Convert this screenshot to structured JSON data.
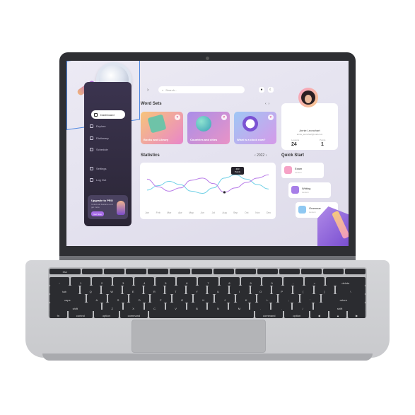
{
  "sidebar": {
    "items": [
      {
        "label": "Dashboard",
        "icon": "home-icon"
      },
      {
        "label": "Explore",
        "icon": "compass-icon"
      },
      {
        "label": "Dictionary",
        "icon": "book-icon"
      },
      {
        "label": "Schedule",
        "icon": "calendar-icon"
      },
      {
        "label": "Settings",
        "icon": "gear-icon"
      },
      {
        "label": "Log Out",
        "icon": "logout-icon"
      }
    ],
    "promo": {
      "title": "Upgrade to PRO",
      "subtitle": "Unlock all features and get more",
      "button": "Get Now"
    }
  },
  "search": {
    "placeholder": "Search..."
  },
  "word_sets": {
    "title": "Word Sets",
    "cards": [
      {
        "label": "Books and Library",
        "colors": [
          "#f7c47a",
          "#e986c9"
        ]
      },
      {
        "label": "Countries and cities",
        "colors": [
          "#a98ee9",
          "#e993c6"
        ]
      },
      {
        "label": "What is a clock now?",
        "colors": [
          "#9ec7f5",
          "#d59ae9"
        ]
      }
    ]
  },
  "profile": {
    "name": "Annie Leonchart",
    "email": "annie_leonchart@mail.com",
    "stats": [
      {
        "label": "Lessons",
        "value": "24"
      },
      {
        "label": "Points",
        "value": "1"
      }
    ]
  },
  "statistics": {
    "title": "Statistics",
    "year": "2022",
    "tooltip_line1": "403",
    "tooltip_line2": "Points"
  },
  "chart_data": {
    "type": "line",
    "categories": [
      "Jan",
      "Feb",
      "Mar",
      "Apr",
      "May",
      "Jun",
      "Jul",
      "Aug",
      "Sep",
      "Oct",
      "Nov",
      "Dec"
    ],
    "series": [
      {
        "values": [
          30,
          38,
          46,
          40,
          28,
          24,
          34,
          52,
          58,
          50,
          40,
          32
        ],
        "color": "#6fd0e6"
      },
      {
        "values": [
          50,
          36,
          28,
          34,
          48,
          52,
          42,
          26,
          34,
          44,
          52,
          58
        ],
        "color": "#b77ae8"
      }
    ],
    "grid": false,
    "legend": "none"
  },
  "quick_start": {
    "title": "Quick Start",
    "items": [
      {
        "title": "Exam",
        "sub": "Lesson",
        "color": "#f6a2c6"
      },
      {
        "title": "Writing",
        "sub": "Lesson",
        "color": "#a77ee8"
      },
      {
        "title": "Grammar",
        "sub": "Lesson",
        "color": "#8fc8f2"
      }
    ]
  },
  "keyboard": {
    "rows": [
      [
        "esc",
        "",
        "",
        "",
        "",
        "",
        "",
        "",
        "",
        "",
        "",
        "",
        "",
        ""
      ],
      [
        "~",
        "1",
        "2",
        "3",
        "4",
        "5",
        "6",
        "7",
        "8",
        "9",
        "0",
        "-",
        "=",
        "delete"
      ],
      [
        "tab",
        "Q",
        "W",
        "E",
        "R",
        "T",
        "Y",
        "U",
        "I",
        "O",
        "P",
        "[",
        "]",
        "\\"
      ],
      [
        "caps",
        "A",
        "S",
        "D",
        "F",
        "G",
        "H",
        "J",
        "K",
        "L",
        ";",
        "'",
        "return"
      ],
      [
        "shift",
        "Z",
        "X",
        "C",
        "V",
        "B",
        "N",
        "M",
        ",",
        ".",
        "/",
        "shift"
      ],
      [
        "fn",
        "control",
        "option",
        "command",
        "",
        "command",
        "option",
        "◀",
        "▲",
        "▶"
      ]
    ]
  },
  "colors": {
    "accent": "#a86de8",
    "sidebar": "#2f2a3b"
  }
}
